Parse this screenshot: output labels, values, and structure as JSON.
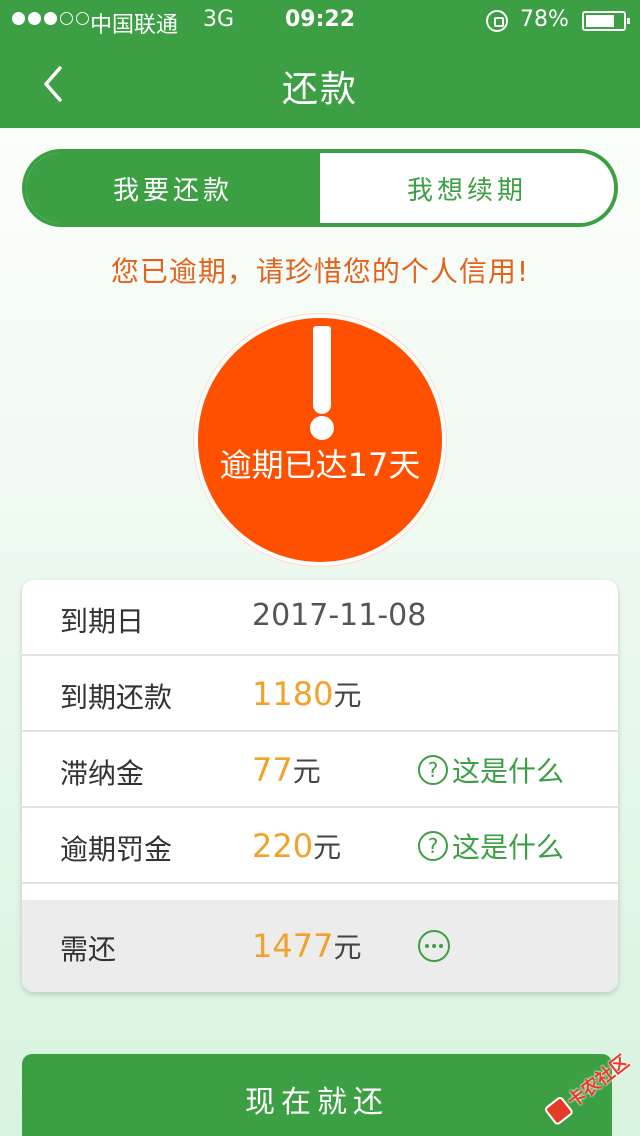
{
  "status_bar": {
    "carrier": "中国联通",
    "network": "3G",
    "time": "09:22",
    "battery_percent": "78%",
    "battery_level": 0.78,
    "signal_bars_filled": 3,
    "signal_bars_total": 5
  },
  "nav": {
    "title": "还款",
    "back_icon": "chevron-left-icon"
  },
  "tabs": [
    {
      "label": "我要还款",
      "active": true
    },
    {
      "label": "我想续期",
      "active": false
    }
  ],
  "warning_message": "您已逾期，请珍惜您的个人信用!",
  "overdue_badge": {
    "text": "逾期已达17天",
    "icon": "exclamation-icon"
  },
  "details": {
    "due_date": {
      "label": "到期日",
      "value": "2017-11-08"
    },
    "due_amount": {
      "label": "到期还款",
      "amount": "1180",
      "unit": "元"
    },
    "late_fee": {
      "label": "滞纳金",
      "amount": "77",
      "unit": "元",
      "help": "这是什么"
    },
    "penalty": {
      "label": "逾期罚金",
      "amount": "220",
      "unit": "元",
      "help": "这是什么"
    },
    "total": {
      "label": "需还",
      "amount": "1477",
      "unit": "元"
    }
  },
  "pay_button_label": "现在就还",
  "watermark_text": "卡农社区",
  "colors": {
    "brand_green": "#3d9f43",
    "alert_orange": "#ff5000",
    "amount_gold": "#f2a22a",
    "warning_text": "#e3631b"
  }
}
